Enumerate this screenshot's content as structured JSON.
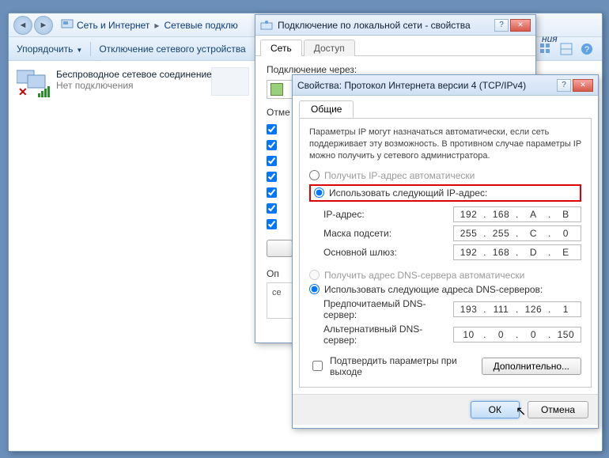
{
  "explorer": {
    "crumb1": "Сеть и Интернет",
    "crumb2": "Сетевые подклю",
    "toolbar": {
      "organize": "Упорядочить",
      "disable": "Отключение сетевого устройства"
    },
    "conn": {
      "name": "Беспроводное сетевое соединение",
      "status": "Нет подключения"
    },
    "end_text": "ния"
  },
  "lan": {
    "title": "Подключение по локальной сети - свойства",
    "tabs": {
      "net": "Сеть",
      "access": "Доступ"
    },
    "connect_via": "Подключение через:",
    "components_label": "Отме"
  },
  "ip": {
    "title": "Свойства: Протокол Интернета версии 4 (TCP/IPv4)",
    "tab": "Общие",
    "desc": "Параметры IP могут назначаться автоматически, если сеть поддерживает эту возможность. В противном случае параметры IP можно получить у сетевого администратора.",
    "radio_auto_ip": "Получить IP-адрес автоматически",
    "radio_manual_ip": "Использовать следующий IP-адрес:",
    "ip_label": "IP-адрес:",
    "mask_label": "Маска подсети:",
    "gw_label": "Основной шлюз:",
    "ip_val": {
      "o1": "192",
      "o2": "168",
      "o3": "A",
      "o4": "B"
    },
    "mask_val": {
      "o1": "255",
      "o2": "255",
      "o3": "C",
      "o4": "0"
    },
    "gw_val": {
      "o1": "192",
      "o2": "168",
      "o3": "D",
      "o4": "E"
    },
    "radio_auto_dns": "Получить адрес DNS-сервера автоматически",
    "radio_manual_dns": "Использовать следующие адреса DNS-серверов:",
    "dns1_label": "Предпочитаемый DNS-сервер:",
    "dns2_label": "Альтернативный DNS-сервер:",
    "dns1_val": {
      "o1": "193",
      "o2": "111",
      "o3": "126",
      "o4": "1"
    },
    "dns2_val": {
      "o1": "10",
      "o2": "0",
      "o3": "0",
      "o4": "150"
    },
    "confirm_exit": "Подтвердить параметры при выходе",
    "advanced": "Дополнительно...",
    "ok": "ОК",
    "cancel": "Отмена"
  },
  "desc_label": "Оп",
  "desc_sub": "се"
}
